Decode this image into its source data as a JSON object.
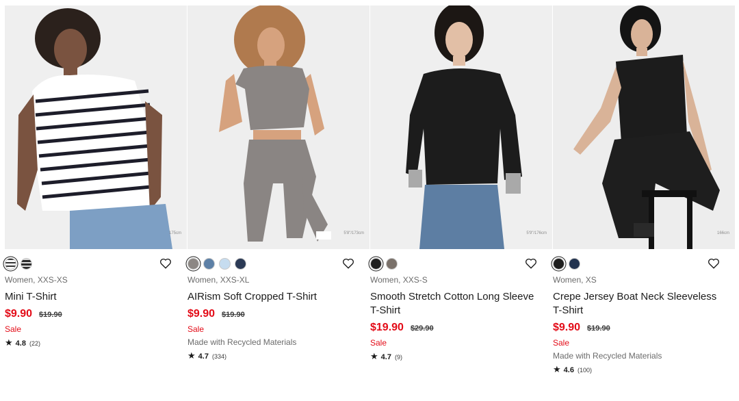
{
  "products": [
    {
      "height_note": "175cm",
      "swatches": [
        {
          "color": "#ffffff",
          "pattern": "stripe-light",
          "selected": true
        },
        {
          "color": "#2a2a2a",
          "pattern": "stripe-dark",
          "selected": false
        }
      ],
      "meta": "Women, XXS-XS",
      "name": "Mini T-Shirt",
      "price": "$9.90",
      "old_price": "$19.90",
      "sale": "Sale",
      "note": "",
      "star": "★",
      "rating": "4.8",
      "reviews": "(22)"
    },
    {
      "height_note": "5'8\"/173cm",
      "swatches": [
        {
          "color": "#8c8784",
          "selected": true
        },
        {
          "color": "#5d80a6",
          "selected": false
        },
        {
          "color": "#c6dcef",
          "selected": false
        },
        {
          "color": "#2b3a55",
          "selected": false
        }
      ],
      "meta": "Women, XXS-XL",
      "name": "AIRism Soft Cropped T-Shirt",
      "price": "$9.90",
      "old_price": "$19.90",
      "sale": "Sale",
      "note": "Made with Recycled Materials",
      "star": "★",
      "rating": "4.7",
      "reviews": "(334)"
    },
    {
      "height_note": "5'9\"/176cm",
      "swatches": [
        {
          "color": "#1f1f1f",
          "selected": true
        },
        {
          "color": "#7a716a",
          "selected": false
        }
      ],
      "meta": "Women, XXS-S",
      "name": "Smooth Stretch Cotton Long Sleeve T-Shirt",
      "price": "$19.90",
      "old_price": "$29.90",
      "sale": "Sale",
      "note": "",
      "star": "★",
      "rating": "4.7",
      "reviews": "(9)"
    },
    {
      "height_note": "166cm",
      "swatches": [
        {
          "color": "#1f1f1f",
          "selected": true
        },
        {
          "color": "#22334f",
          "selected": false
        }
      ],
      "meta": "Women, XS",
      "name": "Crepe Jersey Boat Neck Sleeveless T-Shirt",
      "price": "$9.90",
      "old_price": "$19.90",
      "sale": "Sale",
      "note": "Made with Recycled Materials",
      "star": "★",
      "rating": "4.6",
      "reviews": "(100)"
    }
  ],
  "icons": {
    "favorite": "heart-outline-icon",
    "swatch": "color-swatch"
  }
}
